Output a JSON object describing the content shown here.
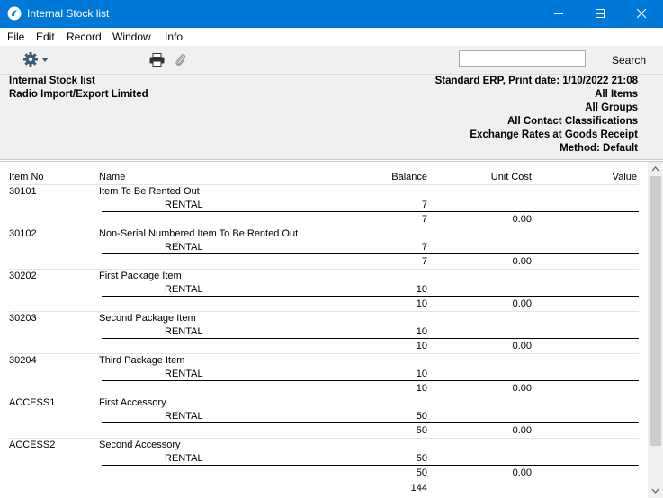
{
  "window": {
    "title": "Internal Stock list"
  },
  "menu": [
    "File",
    "Edit",
    "Record",
    "Window",
    "Info"
  ],
  "toolbar": {
    "search_label": "Search",
    "search_value": ""
  },
  "header": {
    "left": [
      "Internal Stock list",
      "Radio Import/Export Limited"
    ],
    "right": [
      "Standard ERP, Print date: 1/10/2022 21:08",
      "All Items",
      "All Groups",
      "All Contact Classifications",
      "Exchange Rates at Goods Receipt",
      "Method: Default"
    ]
  },
  "report": {
    "columns": {
      "item_no": "Item No",
      "name": "Name",
      "balance": "Balance",
      "unit_cost": "Unit Cost",
      "value": "Value"
    },
    "items": [
      {
        "item_no": "30101",
        "name": "Item To Be Rented Out",
        "location": "RENTAL",
        "loc_balance": "7",
        "total_balance": "7",
        "unit_cost": "0.00"
      },
      {
        "item_no": "30102",
        "name": "Non-Serial Numbered Item To Be Rented Out",
        "location": "RENTAL",
        "loc_balance": "7",
        "total_balance": "7",
        "unit_cost": "0.00"
      },
      {
        "item_no": "30202",
        "name": "First Package Item",
        "location": "RENTAL",
        "loc_balance": "10",
        "total_balance": "10",
        "unit_cost": "0.00"
      },
      {
        "item_no": "30203",
        "name": "Second Package Item",
        "location": "RENTAL",
        "loc_balance": "10",
        "total_balance": "10",
        "unit_cost": "0.00"
      },
      {
        "item_no": "30204",
        "name": "Third Package Item",
        "location": "RENTAL",
        "loc_balance": "10",
        "total_balance": "10",
        "unit_cost": "0.00"
      },
      {
        "item_no": "ACCESS1",
        "name": "First Accessory",
        "location": "RENTAL",
        "loc_balance": "50",
        "total_balance": "50",
        "unit_cost": "0.00"
      },
      {
        "item_no": "ACCESS2",
        "name": "Second Accessory",
        "location": "RENTAL",
        "loc_balance": "50",
        "total_balance": "50",
        "unit_cost": "0.00"
      }
    ],
    "grand_total_balance": "144"
  }
}
